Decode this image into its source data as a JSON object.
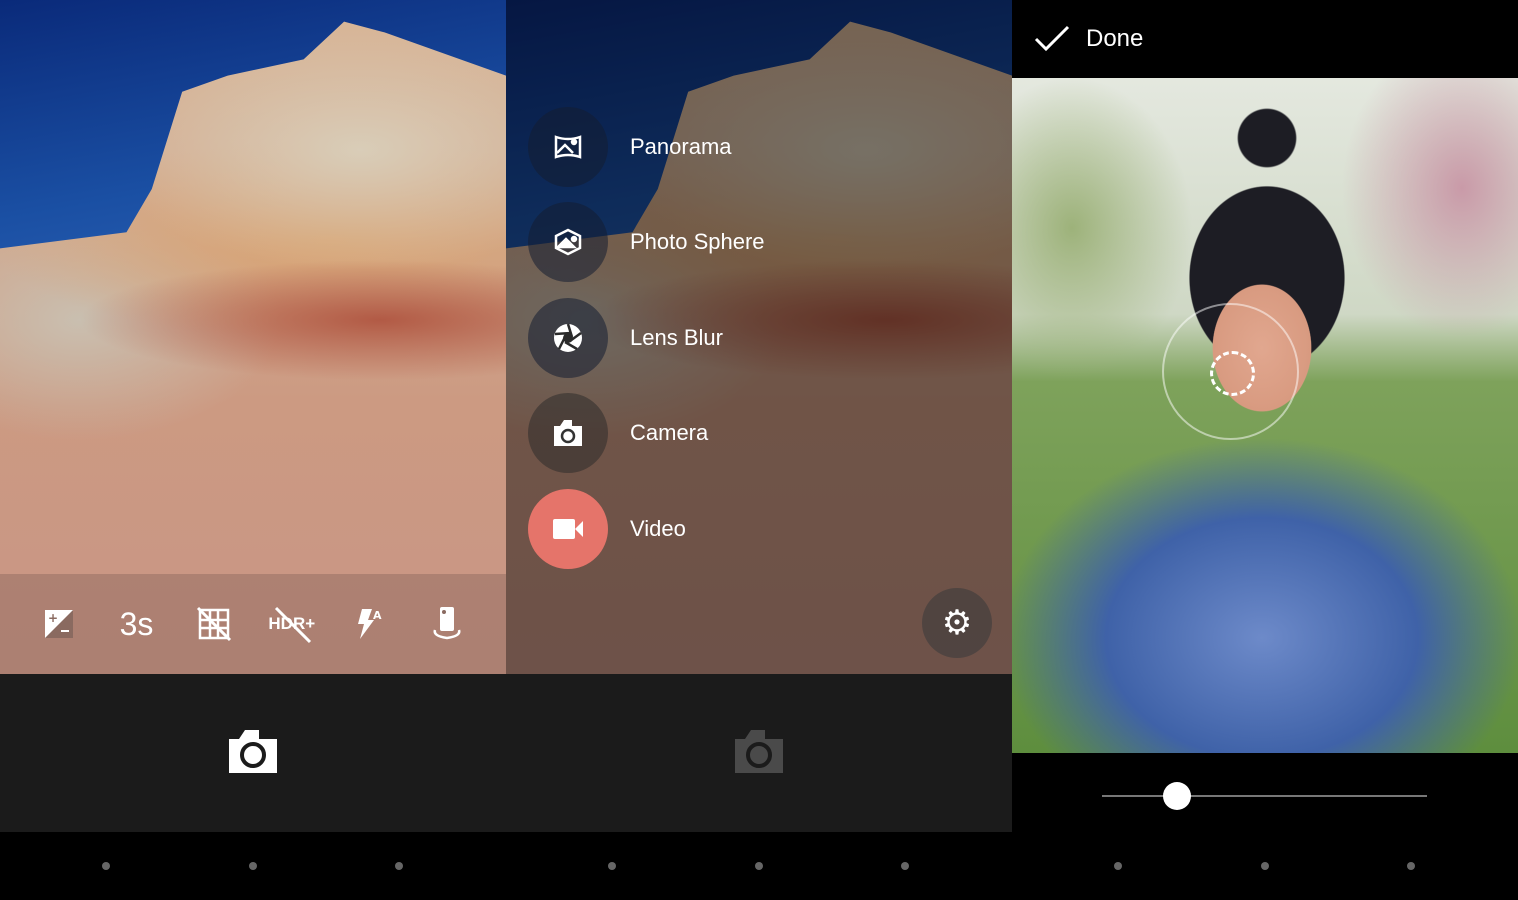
{
  "panel1": {
    "toolbar": [
      {
        "icon": "exposure-icon"
      },
      {
        "label": "3s",
        "icon": "timer-icon"
      },
      {
        "icon": "grid-off-icon"
      },
      {
        "label": "HDR+",
        "icon": "hdr-off-icon"
      },
      {
        "icon": "flash-auto-icon"
      },
      {
        "icon": "switch-camera-icon"
      }
    ],
    "shutter": "camera-shutter-icon"
  },
  "panel2": {
    "modes": [
      {
        "label": "Panorama",
        "icon": "panorama-icon"
      },
      {
        "label": "Photo Sphere",
        "icon": "photo-sphere-icon"
      },
      {
        "label": "Lens Blur",
        "icon": "lens-blur-icon"
      },
      {
        "label": "Camera",
        "icon": "camera-icon"
      },
      {
        "label": "Video",
        "icon": "video-icon",
        "active": true,
        "color": "#e5746a"
      }
    ],
    "settings_icon": "gear-icon"
  },
  "panel3": {
    "done_label": "Done",
    "blur_slider_fraction": 0.23
  },
  "colors": {
    "video_accent": "#e5746a",
    "shutter_bg": "#1b1b1b"
  }
}
